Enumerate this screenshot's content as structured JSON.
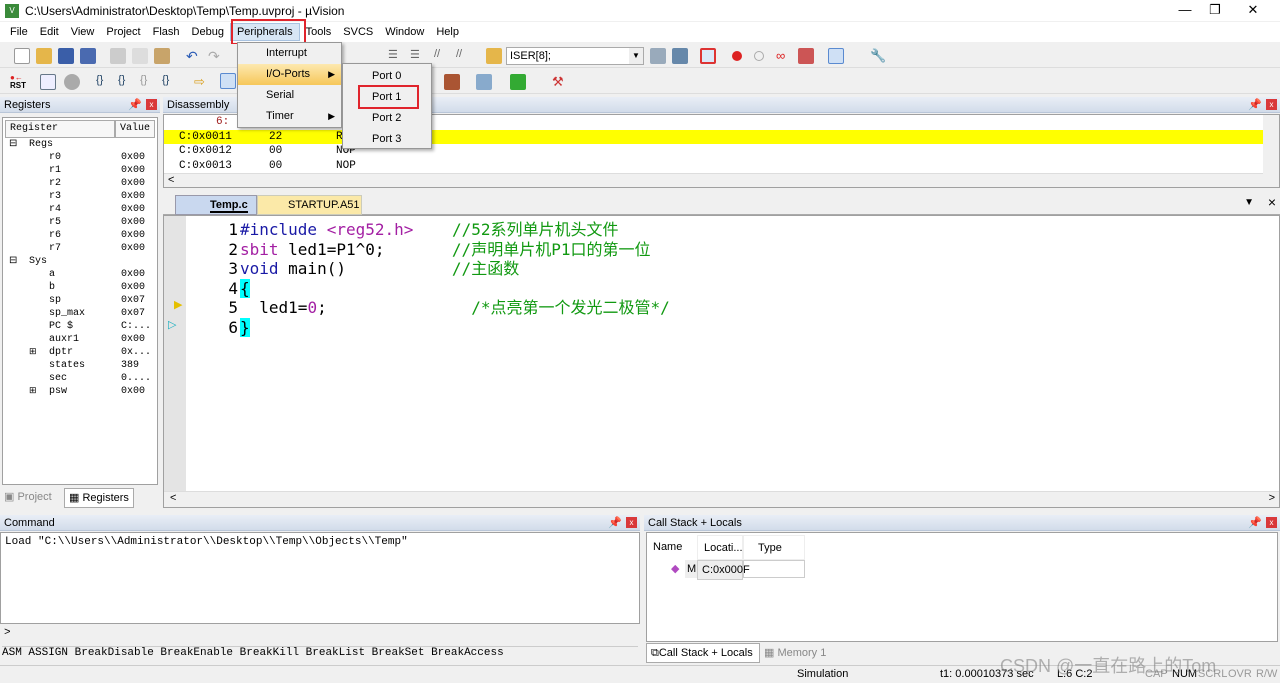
{
  "window": {
    "title": "C:\\Users\\Administrator\\Desktop\\Temp\\Temp.uvproj - µVision",
    "minimize": "—",
    "restore": "❐",
    "close": "✕"
  },
  "menu": [
    "File",
    "Edit",
    "View",
    "Project",
    "Flash",
    "Debug",
    "Peripherals",
    "Tools",
    "SVCS",
    "Window",
    "Help"
  ],
  "peripherals_menu": {
    "items": [
      {
        "label": "Interrupt",
        "arrow": ""
      },
      {
        "label": "I/O-Ports",
        "arrow": "▶"
      },
      {
        "label": "Serial",
        "arrow": ""
      },
      {
        "label": "Timer",
        "arrow": "▶"
      }
    ]
  },
  "ports_menu": [
    "Port 0",
    "Port 1",
    "Port 2",
    "Port 3"
  ],
  "toolbar": {
    "find_label": "ISER[8];",
    "rst": "RST"
  },
  "registers": {
    "title": "Registers",
    "col_register": "Register",
    "col_value": "Value",
    "groups": [
      {
        "name": "Regs",
        "items": [
          [
            "r0",
            "0x00"
          ],
          [
            "r1",
            "0x00"
          ],
          [
            "r2",
            "0x00"
          ],
          [
            "r3",
            "0x00"
          ],
          [
            "r4",
            "0x00"
          ],
          [
            "r5",
            "0x00"
          ],
          [
            "r6",
            "0x00"
          ],
          [
            "r7",
            "0x00"
          ]
        ]
      },
      {
        "name": "Sys",
        "items": [
          [
            "a",
            "0x00"
          ],
          [
            "b",
            "0x00"
          ],
          [
            "sp",
            "0x07"
          ],
          [
            "sp_max",
            "0x07"
          ],
          [
            "PC  $",
            "C:..."
          ],
          [
            "auxr1",
            "0x00"
          ],
          [
            "dptr",
            "0x..."
          ],
          [
            "states",
            "389"
          ],
          [
            "sec",
            "0...."
          ],
          [
            "psw",
            "0x00"
          ]
        ]
      }
    ],
    "tabs": [
      "Project",
      "Registers"
    ]
  },
  "disassembly": {
    "title": "Disassembly",
    "line_label": "6:",
    "rows": [
      [
        "C:0x0011",
        "22",
        "R"
      ],
      [
        "C:0x0012",
        "00",
        "NOP"
      ],
      [
        "C:0x0013",
        "00",
        "NOP"
      ]
    ]
  },
  "editor": {
    "tabs": [
      "Temp.c",
      "STARTUP.A51"
    ],
    "lines": [
      {
        "n": "1",
        "parts": [
          [
            "#include ",
            "#1a1aa6"
          ],
          [
            "<reg52.h>",
            "#a31fa3"
          ],
          [
            "    //52系列单片机头文件",
            "#119911"
          ]
        ]
      },
      {
        "n": "2",
        "parts": [
          [
            "sbit",
            "#a31fa3"
          ],
          [
            " led1=P1^0;       ",
            "#000"
          ],
          [
            "//声明单片机P1口的第一位",
            "#119911"
          ]
        ]
      },
      {
        "n": "3",
        "parts": [
          [
            "void",
            "#1a1aa6"
          ],
          [
            " main()           ",
            "#000"
          ],
          [
            "//主函数",
            "#119911"
          ]
        ]
      },
      {
        "n": "4",
        "parts": [
          [
            "{",
            "#000"
          ]
        ]
      },
      {
        "n": "5",
        "parts": [
          [
            "  led1=",
            "#000"
          ],
          [
            "0",
            "#a31fa3"
          ],
          [
            ";               ",
            "#000"
          ],
          [
            "/*点亮第一个发光二极管*/",
            "#119911"
          ]
        ]
      },
      {
        "n": "6",
        "parts": [
          [
            "}",
            "#000"
          ]
        ]
      }
    ]
  },
  "command": {
    "title": "Command",
    "output": "Load \"C:\\\\Users\\\\Administrator\\\\Desktop\\\\Temp\\\\Objects\\\\Temp\"",
    "prompt": ">",
    "hints": "ASM ASSIGN BreakDisable BreakEnable BreakKill BreakList BreakSet BreakAccess"
  },
  "callstack": {
    "title": "Call Stack + Locals",
    "cols": [
      "Name",
      "Locati...",
      "Type"
    ],
    "row": [
      "M",
      "C:0x000F",
      ""
    ],
    "tabs": [
      "Call Stack + Locals",
      "Memory 1"
    ]
  },
  "status": {
    "mode": "Simulation",
    "time": "t1: 0.00010373 sec",
    "pos": "L:6 C:2",
    "flags": [
      "CAP",
      "NUM",
      "SCRL",
      "OVR",
      "R/W"
    ]
  },
  "watermark": "CSDN @一直在路上的Tom"
}
